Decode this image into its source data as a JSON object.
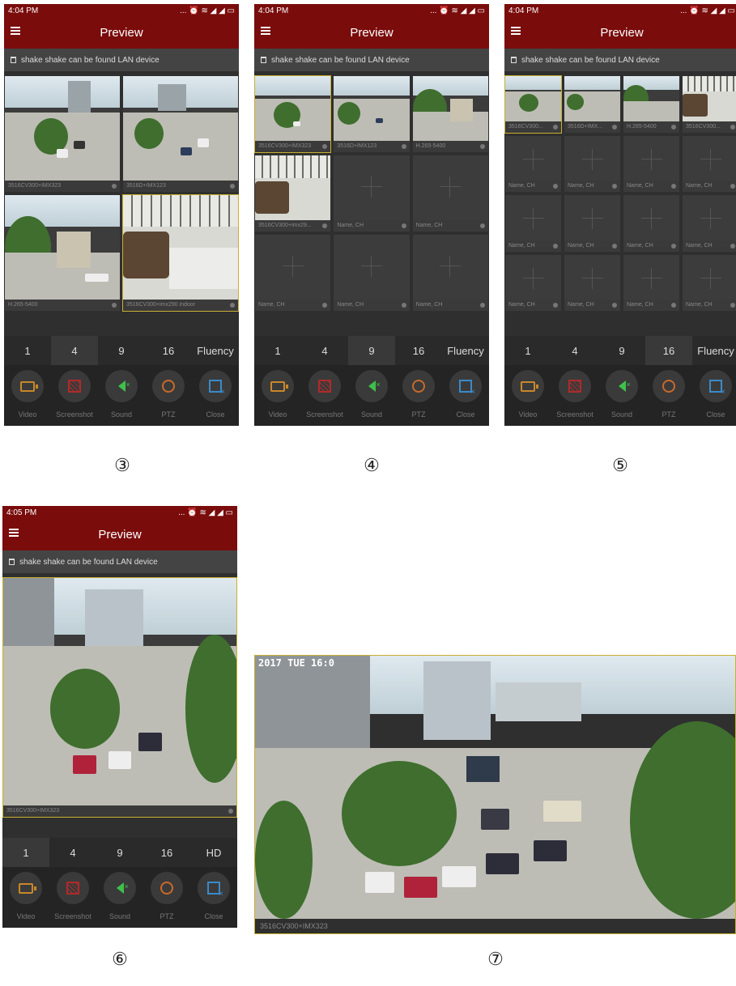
{
  "status": {
    "time_a": "4:04 PM",
    "time_b": "4:05 PM",
    "icons": "... ⏰ ≋ ◢ ◢ ▭"
  },
  "header": {
    "title": "Preview"
  },
  "tip": {
    "text": "shake shake can be found LAN device"
  },
  "tabs": [
    "1",
    "4",
    "9",
    "16",
    "Fluency",
    "HD"
  ],
  "tools": {
    "video": "Video",
    "screenshot": "Screenshot",
    "sound": "Sound",
    "ptz": "PTZ",
    "close": "Close"
  },
  "cams": {
    "c1": "3516CV300+IMX323",
    "c2": "3516D+IMX123",
    "c3": "H.265-5400",
    "c4": "3516CV300+imx290 indoor",
    "c4b": "3516CV300+imx29...",
    "c1b": "3516CV300+IMX323",
    "c2s": "3516D+IMX...",
    "c3s": "H.265-5400",
    "c1s": "3516CV300...",
    "c4s": "3516CV300...",
    "empty": "Name, CH"
  },
  "labels": {
    "l3": "③",
    "l4": "④",
    "l5": "⑤",
    "l6": "⑥",
    "l7": "⑦"
  },
  "land": {
    "caption": "3516CV300+IMX323",
    "stamp": "2017 TUE 16:0"
  },
  "colors": {
    "header": "#7a0c0c",
    "selected": "#c8b030"
  }
}
